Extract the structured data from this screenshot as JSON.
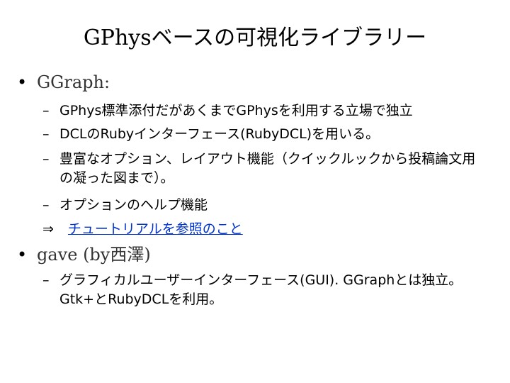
{
  "slide": {
    "title": "GPhysベースの可視化ライブラリー",
    "bullets": [
      {
        "marker": "•",
        "text": "GGraph:",
        "subitems": [
          {
            "marker": "–",
            "text": "GPhys標準添付だがあくまでGPhysを利用する立場で独立"
          },
          {
            "marker": "–",
            "text": "DCLのRubyインターフェース(RubyDCL)を用いる。"
          },
          {
            "marker": "–",
            "text": "豊富なオプション、レイアウト機能（クイックルックから投稿論文用の凝った図まで）。"
          },
          {
            "marker": "–",
            "text": "オプションのヘルプ機能"
          }
        ],
        "link": {
          "marker": "⇒",
          "text": "チュートリアルを参照のこと"
        }
      },
      {
        "marker": "•",
        "text": "gave (by西澤)",
        "subitems": [
          {
            "marker": "–",
            "text": "グラフィカルユーザーインターフェース(GUI). GGraphとは独立。Gtk+とRubyDCLを利用。"
          }
        ]
      }
    ]
  },
  "colors": {
    "link": "#0033cc",
    "level1_text": "#333333"
  }
}
